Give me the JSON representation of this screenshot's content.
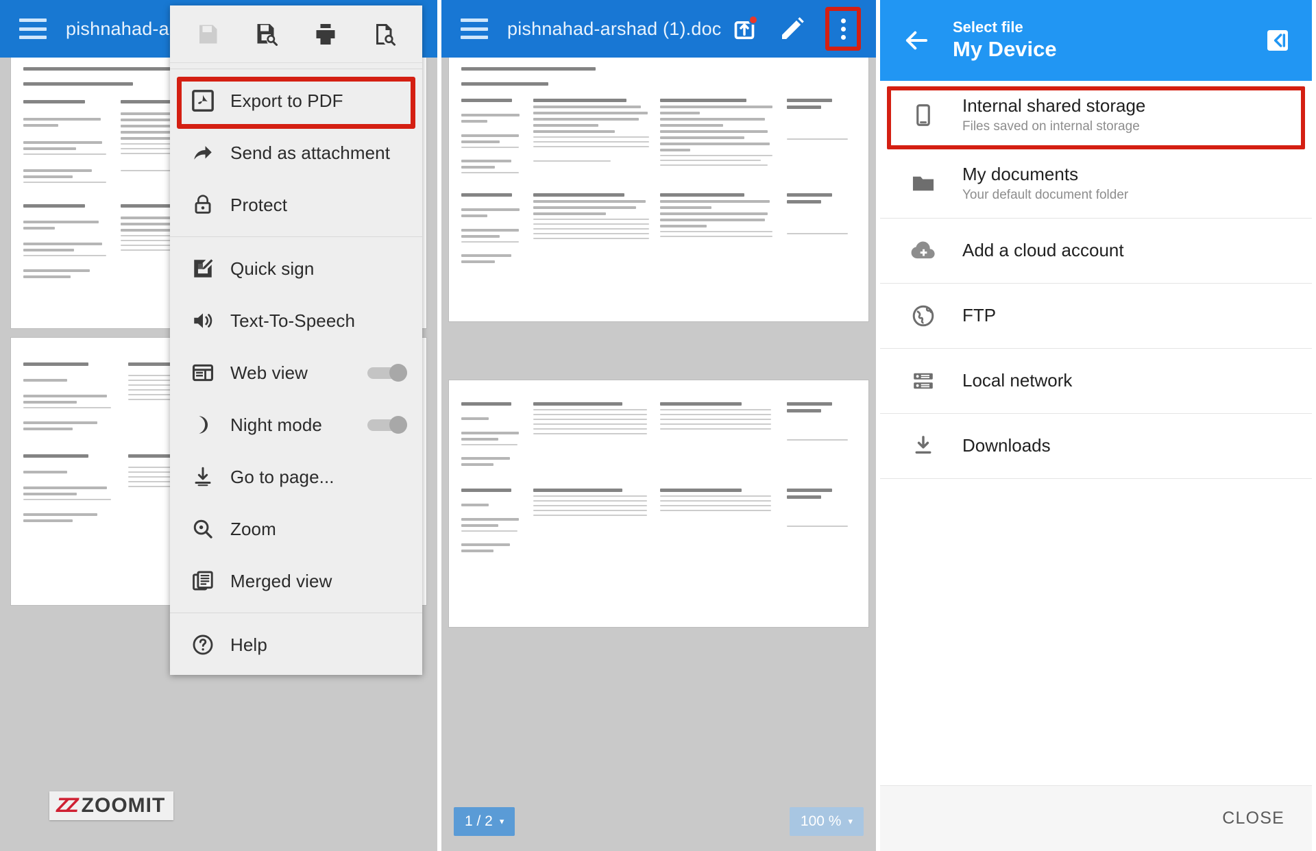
{
  "left_panel": {
    "appbar": {
      "menu_icon": "hamburger-icon",
      "title": "pishnahad-arsha"
    },
    "overflow_menu": {
      "toolbar": [
        {
          "icon": "save-icon",
          "label": "Save",
          "disabled": true
        },
        {
          "icon": "save-as-icon",
          "label": "Save as",
          "disabled": false
        },
        {
          "icon": "print-icon",
          "label": "Print",
          "disabled": false
        },
        {
          "icon": "print-preview-icon",
          "label": "Print preview",
          "disabled": false
        }
      ],
      "items": [
        {
          "icon": "pdf-icon",
          "label": "Export to PDF",
          "type": "action",
          "highlighted": true
        },
        {
          "icon": "share-arrow-icon",
          "label": "Send as attachment",
          "type": "action"
        },
        {
          "icon": "lock-icon",
          "label": "Protect",
          "type": "action"
        },
        {
          "icon": "quick-sign-icon",
          "label": "Quick sign",
          "type": "action"
        },
        {
          "icon": "speaker-icon",
          "label": "Text-To-Speech",
          "type": "action"
        },
        {
          "icon": "web-view-icon",
          "label": "Web view",
          "type": "toggle",
          "value": "off"
        },
        {
          "icon": "moon-icon",
          "label": "Night mode",
          "type": "toggle",
          "value": "off"
        },
        {
          "icon": "go-to-page-icon",
          "label": "Go to page...",
          "type": "action"
        },
        {
          "icon": "magnifier-icon",
          "label": "Zoom",
          "type": "action"
        },
        {
          "icon": "merged-view-icon",
          "label": "Merged view",
          "type": "action"
        },
        {
          "icon": "help-icon",
          "label": "Help",
          "type": "action"
        }
      ]
    },
    "watermark": {
      "mark": "ZZ",
      "text": "ZOOMIT"
    }
  },
  "mid_panel": {
    "appbar": {
      "menu_icon": "hamburger-icon",
      "title": "pishnahad-arshad (1).doc",
      "actions": [
        {
          "icon": "upload-cloud-icon",
          "name": "save-to-cloud-button",
          "badge": true
        },
        {
          "icon": "pencil-icon",
          "name": "edit-button",
          "badge": false
        },
        {
          "icon": "kebab-menu-icon",
          "name": "overflow-menu-button",
          "badge": false,
          "highlighted": true
        }
      ]
    },
    "bottom": {
      "page_indicator": "1 / 2",
      "zoom_level": "100 %",
      "chevron": "chevron-down-icon"
    }
  },
  "right_panel": {
    "appbar": {
      "back_icon": "back-arrow-icon",
      "subtitle": "Select file",
      "title": "My Device",
      "action_icon": "new-folder-icon"
    },
    "items": [
      {
        "icon": "phone-icon",
        "title": "Internal shared storage",
        "subtitle": "Files saved on internal storage",
        "highlighted": true
      },
      {
        "icon": "folder-icon",
        "title": "My documents",
        "subtitle": "Your default document folder",
        "highlighted": false
      },
      {
        "icon": "cloud-add-icon",
        "title": "Add a cloud account",
        "subtitle": "",
        "highlighted": false
      },
      {
        "icon": "globe-icon",
        "title": "FTP",
        "subtitle": "",
        "highlighted": false
      },
      {
        "icon": "server-icon",
        "title": "Local network",
        "subtitle": "",
        "highlighted": false
      },
      {
        "icon": "download-icon",
        "title": "Downloads",
        "subtitle": "",
        "highlighted": false
      }
    ],
    "footer": {
      "close_label": "CLOSE"
    }
  },
  "colors": {
    "appbar_blue": "#1878d2",
    "picker_blue": "#2196f3",
    "highlight_red": "#d41f12",
    "badge_red": "#e8372a",
    "canvas_gray": "#c9c9c9",
    "menu_bg": "#eeeeee",
    "chip_blue": "#5a9bd6",
    "chip_dim": "#a8c6e2"
  }
}
